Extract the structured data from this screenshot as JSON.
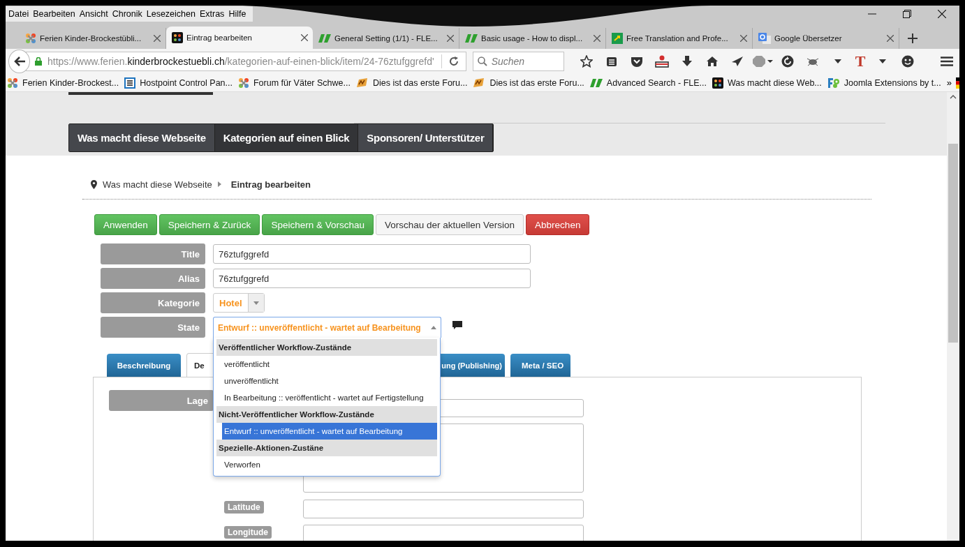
{
  "menu_bar": [
    "Datei",
    "Bearbeiten",
    "Ansicht",
    "Chronik",
    "Lesezeichen",
    "Extras",
    "Hilfe"
  ],
  "browser_tabs": [
    {
      "title": "Ferien Kinder-Brockestübli...",
      "kind": "joomla",
      "selected": false
    },
    {
      "title": "Eintrag bearbeiten",
      "kind": "joomlabox",
      "selected": true
    },
    {
      "title": "General Setting (1/1) - FLE...",
      "kind": "flexi",
      "selected": false
    },
    {
      "title": "Basic usage - How to displ...",
      "kind": "flexi",
      "selected": false
    },
    {
      "title": "Free Translation and Profe...",
      "kind": "translate",
      "selected": false
    },
    {
      "title": "Google Übersetzer",
      "kind": "google",
      "selected": false
    }
  ],
  "address_bar": {
    "prefix": "https://www.ferien.",
    "host": "kinderbrockestuebli.ch",
    "path": "/kategorien-auf-einen-blick/item/24-76ztufggrefd'"
  },
  "search": {
    "placeholder": "Suchen"
  },
  "toolbar_text_icon": "T",
  "bookmarks": [
    {
      "title": "Ferien Kinder-Brockest...",
      "kind": "joomla"
    },
    {
      "title": "Hostpoint Control Pan...",
      "kind": "hostpoint"
    },
    {
      "title": "Forum für Väter Schwe...",
      "kind": "joomla"
    },
    {
      "title": "Dies ist das erste Foru...",
      "kind": "forum"
    },
    {
      "title": "Dies ist das erste Foru...",
      "kind": "forum"
    },
    {
      "title": "Advanced Search - FLE...",
      "kind": "flexi"
    },
    {
      "title": "Was macht diese Web...",
      "kind": "joomlabox"
    },
    {
      "title": "Joomla Extensions by t...",
      "kind": "extensions"
    }
  ],
  "bookmarks_overflow": "»",
  "site_nav": [
    {
      "label": "Was macht diese Webseite",
      "selected": false
    },
    {
      "label": "Kategorien auf einen Blick",
      "selected": true
    },
    {
      "label": "Sponsoren/ Unterstützer",
      "selected": false
    }
  ],
  "breadcrumb": [
    "Was macht diese Webseite",
    "Eintrag bearbeiten"
  ],
  "actions": [
    {
      "label": "Anwenden",
      "kind": "success"
    },
    {
      "label": "Speichern & Zurück",
      "kind": "success"
    },
    {
      "label": "Speichern & Vorschau",
      "kind": "success"
    },
    {
      "label": "Vorschau der aktuellen Version",
      "kind": "default"
    },
    {
      "label": "Abbrechen",
      "kind": "danger"
    }
  ],
  "fields": [
    {
      "label": "Title",
      "kind": "text",
      "value": "76ztufggrefd"
    },
    {
      "label": "Alias",
      "kind": "text",
      "value": "76ztufggrefd"
    },
    {
      "label": "Kategorie",
      "kind": "select",
      "value": "Hotel"
    },
    {
      "label": "State",
      "kind": "dropdown",
      "value": "Entwurf :: unveröffentlicht - wartet auf Bearbeitung",
      "expanded": true
    }
  ],
  "state_options": [
    {
      "kind": "group",
      "label": "Veröffentlicher Workflow-Zustände"
    },
    {
      "kind": "option",
      "label": "veröffentlicht",
      "selected": false
    },
    {
      "kind": "option",
      "label": "unveröffentlicht",
      "selected": false
    },
    {
      "kind": "option",
      "label": "In Bearbeitung :: veröffentlicht - wartet auf Fertigstellung",
      "selected": false
    },
    {
      "kind": "group",
      "label": "Nicht-Veröffentlicher Workflow-Zustände"
    },
    {
      "kind": "option",
      "label": "Entwurf :: unveröffentlicht - wartet auf Bearbeitung",
      "selected": true
    },
    {
      "kind": "group",
      "label": "Spezielle-Aktionen-Zustäne"
    },
    {
      "kind": "option",
      "label": "Verworfen",
      "selected": false
    }
  ],
  "content_tabs": [
    {
      "label": "Beschreibung",
      "selected": false
    },
    {
      "label": "De",
      "selected": true
    },
    {
      "label": "ung (Publishing)",
      "selected": false
    },
    {
      "label": "Meta / SEO",
      "selected": false
    }
  ],
  "panel": {
    "section_label": "Lage",
    "coordinates": [
      {
        "label": "Latitude"
      },
      {
        "label": "Longitude"
      }
    ]
  }
}
